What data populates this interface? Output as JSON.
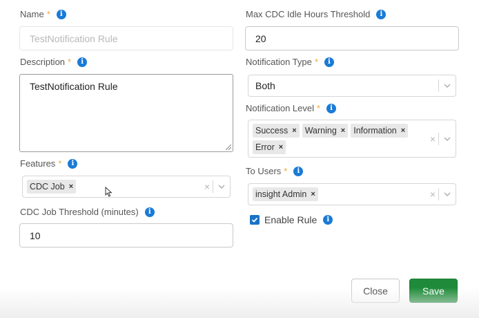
{
  "colors": {
    "required": "#f0a83c",
    "info": "#1a7bd6",
    "save": "#1f8b3a",
    "checkbox": "#1a73c7"
  },
  "name": {
    "label": "Name",
    "required_mark": "*",
    "value": "TestNotification Rule"
  },
  "max_cdc": {
    "label": "Max CDC Idle Hours Threshold",
    "value": "20"
  },
  "description": {
    "label": "Description",
    "required_mark": "*",
    "value": "TestNotification Rule"
  },
  "notification_type": {
    "label": "Notification Type",
    "required_mark": "*",
    "value": "Both"
  },
  "notification_level": {
    "label": "Notification Level",
    "required_mark": "*",
    "tags": [
      "Success",
      "Warning",
      "Information",
      "Error"
    ]
  },
  "features": {
    "label": "Features",
    "required_mark": "*",
    "tags": [
      "CDC Job"
    ]
  },
  "to_users": {
    "label": "To Users",
    "required_mark": "*",
    "tags": [
      "insight Admin"
    ]
  },
  "cdc_job_threshold": {
    "label": "CDC Job Threshold (minutes)",
    "value": "10"
  },
  "enable_rule": {
    "label": "Enable Rule",
    "checked": true
  },
  "icons": {
    "info": "info-icon",
    "tag_remove": "×",
    "clear": "×",
    "chevron": "chevron-down-icon",
    "info_glyph": "i"
  },
  "buttons": {
    "close": "Close",
    "save": "Save"
  }
}
